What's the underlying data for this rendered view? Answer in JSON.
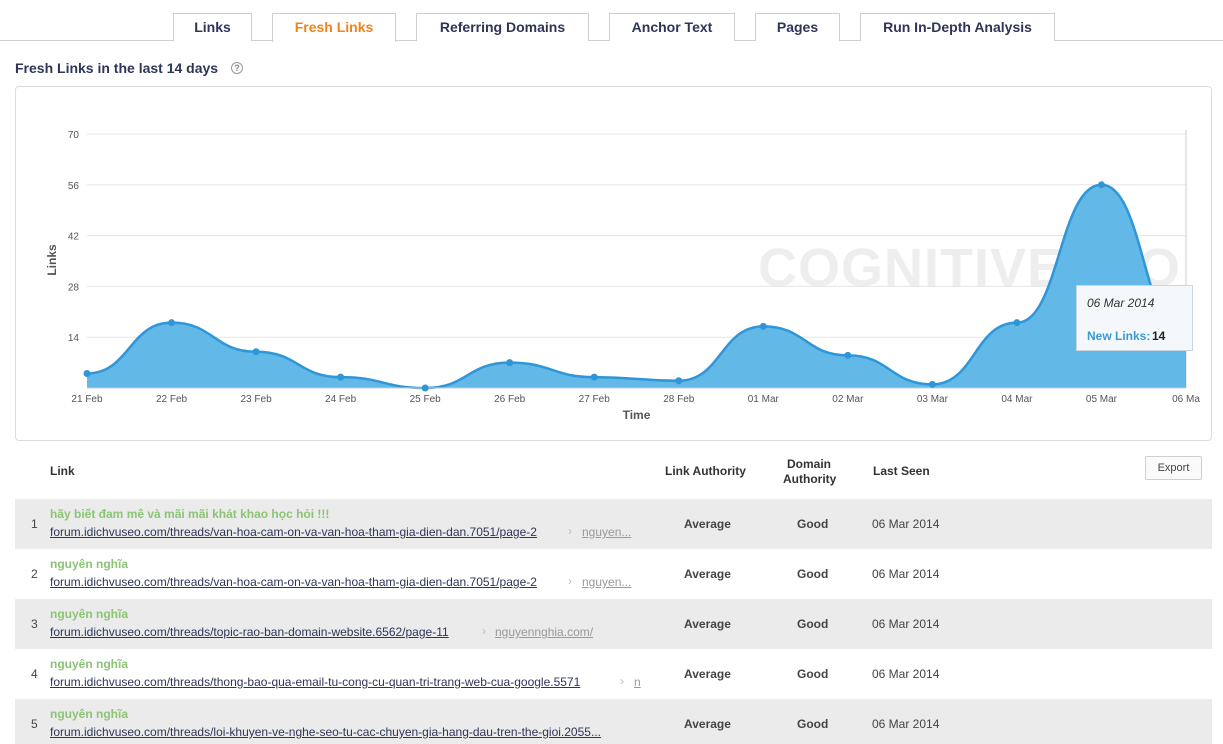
{
  "tabs": [
    {
      "label": "Links",
      "active": false
    },
    {
      "label": "Fresh Links",
      "active": true
    },
    {
      "label": "Referring Domains",
      "active": false
    },
    {
      "label": "Anchor Text",
      "active": false
    },
    {
      "label": "Pages",
      "active": false
    },
    {
      "label": "Run In-Depth Analysis",
      "active": false
    }
  ],
  "section_title": "Fresh Links in the last 14 days",
  "help_icon_glyph": "?",
  "watermark": "COGNITIVESEO",
  "tooltip": {
    "date": "06 Mar 2014",
    "label": "New Links:",
    "value": "14"
  },
  "colors": {
    "area": "#5ab4e6",
    "line": "#2f96d8",
    "accent": "#f0841c",
    "tab_text": "#2d3558",
    "anchor_green": "#8ac574"
  },
  "chart_data": {
    "type": "area",
    "x": [
      "21 Feb",
      "22 Feb",
      "23 Feb",
      "24 Feb",
      "25 Feb",
      "26 Feb",
      "27 Feb",
      "28 Feb",
      "01 Mar",
      "02 Mar",
      "03 Mar",
      "04 Mar",
      "05 Mar",
      "06 Ma"
    ],
    "series": [
      {
        "values": [
          4,
          18,
          10,
          3,
          0,
          7,
          3,
          2,
          17,
          9,
          1,
          18,
          56,
          14
        ]
      }
    ],
    "xlabel": "Time",
    "ylabel": "Links",
    "ylim": [
      0,
      70
    ],
    "yticks": [
      14,
      28,
      42,
      56,
      70
    ],
    "grid": true,
    "highlight_index": 13
  },
  "table": {
    "headers": {
      "link": "Link",
      "link_authority": "Link Authority",
      "domain_authority_1": "Domain",
      "domain_authority_2": "Authority",
      "last_seen": "Last Seen"
    },
    "export_label": "Export",
    "rows": [
      {
        "index": "1",
        "anchor": "hãy biết đam mê và mãi mãi khát khao học hỏi !!!",
        "url": "forum.idichvuseo.com/threads/van-hoa-cam-on-va-van-hoa-tham-gia-dien-dan.7051/page-2",
        "target": "nguyen...",
        "link_authority": "Average",
        "domain_authority": "Good",
        "last_seen": "06 Mar 2014"
      },
      {
        "index": "2",
        "anchor": "nguyên nghĩa",
        "url": "forum.idichvuseo.com/threads/van-hoa-cam-on-va-van-hoa-tham-gia-dien-dan.7051/page-2",
        "target": "nguyen...",
        "link_authority": "Average",
        "domain_authority": "Good",
        "last_seen": "06 Mar 2014"
      },
      {
        "index": "3",
        "anchor": "nguyên nghĩa",
        "url": "forum.idichvuseo.com/threads/topic-rao-ban-domain-website.6562/page-11",
        "target": "nguyennghia.com/",
        "link_authority": "Average",
        "domain_authority": "Good",
        "last_seen": "06 Mar 2014"
      },
      {
        "index": "4",
        "anchor": "nguyên nghĩa",
        "url": "forum.idichvuseo.com/threads/thong-bao-qua-email-tu-cong-cu-quan-tri-trang-web-cua-google.5571",
        "target": "n",
        "link_authority": "Average",
        "domain_authority": "Good",
        "last_seen": "06 Mar 2014"
      },
      {
        "index": "5",
        "anchor": "nguyên nghĩa",
        "url": "forum.idichvuseo.com/threads/loi-khuyen-ve-nghe-seo-tu-cac-chuyen-gia-hang-dau-tren-the-gioi.2055...",
        "target": "",
        "link_authority": "Average",
        "domain_authority": "Good",
        "last_seen": "06 Mar 2014"
      }
    ]
  }
}
